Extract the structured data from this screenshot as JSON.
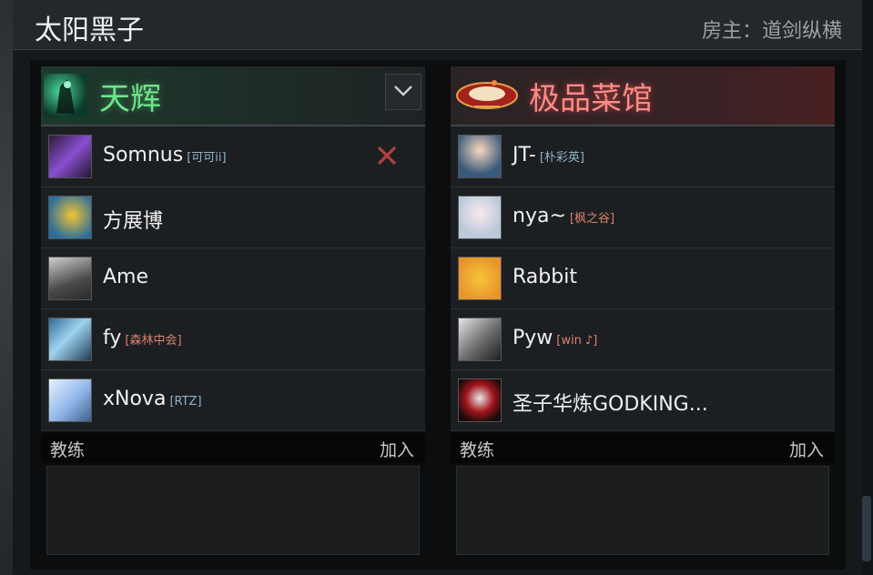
{
  "room": {
    "title": "太阳黑子",
    "host_label": "房主：道剑纵横"
  },
  "radiant": {
    "name": "天辉",
    "players": [
      {
        "name": "Somnus",
        "tag": "[可可ii]"
      },
      {
        "name": "方展博",
        "tag": ""
      },
      {
        "name": "Ame",
        "tag": ""
      },
      {
        "name": "fy",
        "tag": "[森林中会]"
      },
      {
        "name": "xNova",
        "tag": "[RTZ]"
      }
    ],
    "coach_label": "教练",
    "join_label": "加入"
  },
  "dire": {
    "name": "极品菜馆",
    "players": [
      {
        "name": "JT-",
        "tag": "[朴彩英]"
      },
      {
        "name": "nya~",
        "tag": "[枫之谷]"
      },
      {
        "name": "Rabbit",
        "tag": ""
      },
      {
        "name": "Pyw",
        "tag": "[win ♪]"
      },
      {
        "name": "圣子华炼GODKING...",
        "tag": ""
      }
    ],
    "coach_label": "教练",
    "join_label": "加入"
  },
  "colors": {
    "radiant": "#6fe58b",
    "dire": "#ff8a86",
    "kick": "#b3403c"
  },
  "icons": {
    "kick": "close-icon",
    "expand": "chevron-down-icon"
  }
}
